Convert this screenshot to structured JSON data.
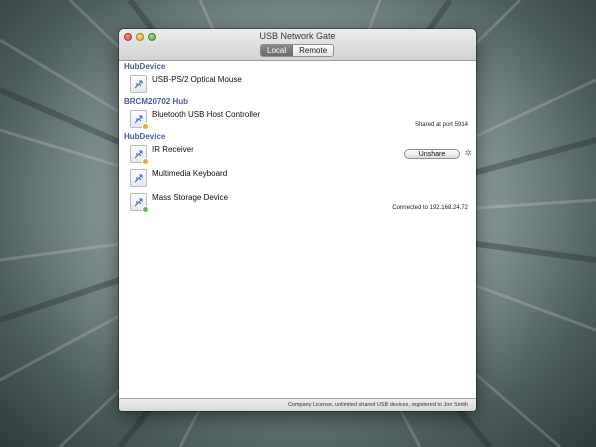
{
  "window": {
    "title": "USB Network Gate"
  },
  "tabs": [
    {
      "label": "Local",
      "active": true
    },
    {
      "label": "Remote",
      "active": false
    }
  ],
  "groups": [
    {
      "name": "HubDevice",
      "devices": [
        {
          "name": "USB-PS/2 Optical Mouse",
          "status": "",
          "badge": ""
        }
      ]
    },
    {
      "name": "BRCM20702 Hub",
      "devices": [
        {
          "name": "Bluetooth USB Host Controller",
          "status": "Shared at port 5914",
          "badge": "orange"
        }
      ]
    },
    {
      "name": "HubDevice",
      "devices": [
        {
          "name": "IR Receiver",
          "status": "",
          "badge": "orange",
          "button": "Unshare"
        },
        {
          "name": "Multimedia Keyboard",
          "status": "",
          "badge": ""
        },
        {
          "name": "Mass Storage Device",
          "status": "Connected to 192.168.24.72",
          "badge": "green"
        }
      ]
    }
  ],
  "footer": {
    "text": "Company License, unlimited shared USB devices, registered to Jon Smith"
  },
  "colors": {
    "group_header": "#4a5aa0",
    "badge_orange": "#e2b12a",
    "badge_green": "#62b84a"
  },
  "icons": {
    "device": "usb-device-icon",
    "settings": "gear-icon"
  }
}
